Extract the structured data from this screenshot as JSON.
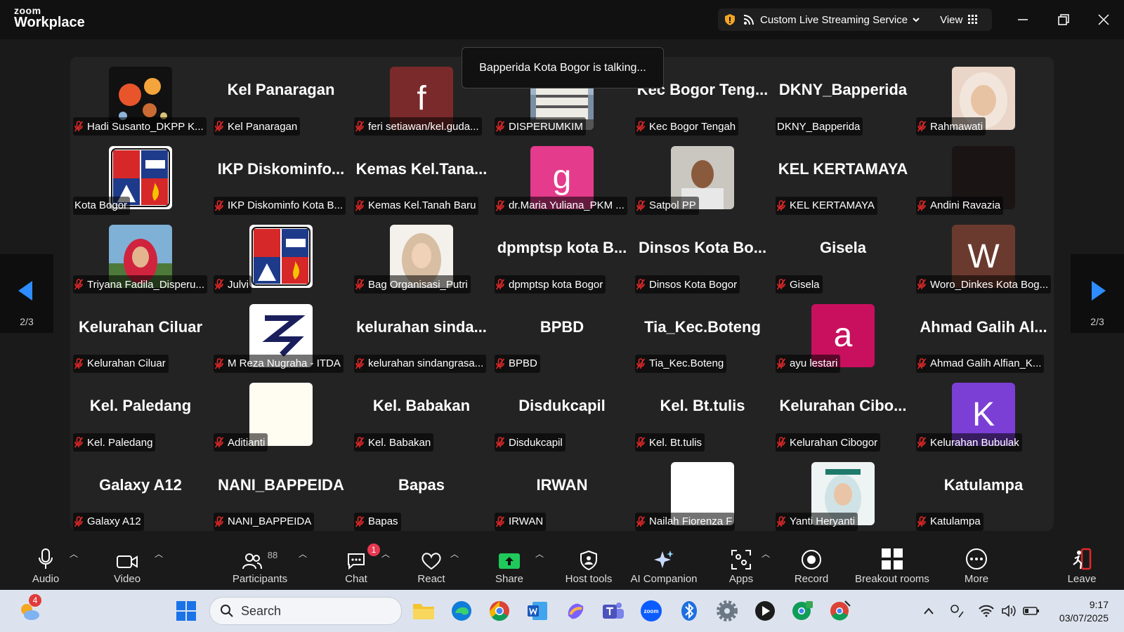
{
  "app": {
    "brand_top": "zoom",
    "brand_bottom": "Workplace"
  },
  "streaming": {
    "label": "Custom Live Streaming Service",
    "view_label": "View"
  },
  "toast": "Bapperida Kota Bogor is talking...",
  "page_indicator": {
    "left": "2/3",
    "right": "2/3"
  },
  "participants": [
    {
      "name": "Hadi Susanto_DKPP K...",
      "avatar": "planets",
      "big": ""
    },
    {
      "name": "Kel Panaragan",
      "big": "Kel Panaragan"
    },
    {
      "name": "feri setiawan/kel.guda...",
      "avatar": "letter",
      "letter": "f",
      "color": "#7a2a2a",
      "big": ""
    },
    {
      "name": "DISPERUMKIM",
      "avatar": "building",
      "big": ""
    },
    {
      "name": "Kec Bogor Tengah",
      "big": "Kec Bogor Teng..."
    },
    {
      "name": "DKNY_Bapperida",
      "big": "DKNY_Bapperida",
      "muted": false
    },
    {
      "name": "Rahmawati",
      "avatar": "photo-hijab-light",
      "big": ""
    },
    {
      "name": "Kota Bogor",
      "avatar": "crest-kota",
      "big": "",
      "muted": false
    },
    {
      "name": "IKP Diskominfo Kota B...",
      "big": "IKP Diskominfo..."
    },
    {
      "name": "Kemas Kel.Tanah Baru",
      "big": "Kemas Kel.Tana..."
    },
    {
      "name": "dr.Maria Yuliana_PKM ...",
      "avatar": "letter",
      "letter": "g",
      "color": "#e53b8c",
      "big": ""
    },
    {
      "name": "Satpol PP",
      "avatar": "photo-man",
      "big": ""
    },
    {
      "name": "KEL KERTAMAYA",
      "big": "KEL KERTAMAYA"
    },
    {
      "name": "Andini Ravazia",
      "avatar": "dark",
      "big": ""
    },
    {
      "name": "Triyana Fadila_Disperu...",
      "avatar": "photo-hijab-red",
      "big": ""
    },
    {
      "name": "Julvi",
      "avatar": "crest",
      "big": ""
    },
    {
      "name": "Bag Organisasi_Putri",
      "avatar": "photo-hijab-beige",
      "big": ""
    },
    {
      "name": "dpmptsp kota Bogor",
      "big": "dpmptsp kota B..."
    },
    {
      "name": "Dinsos Kota Bogor",
      "big": "Dinsos Kota Bo..."
    },
    {
      "name": "Gisela",
      "big": "Gisela"
    },
    {
      "name": "Woro_Dinkes Kota Bog...",
      "avatar": "letter",
      "letter": "W",
      "color": "#6b3a2e",
      "big": ""
    },
    {
      "name": "Kelurahan Ciluar",
      "big": "Kelurahan Ciluar"
    },
    {
      "name": "M Reza Nugraha - ITDA",
      "avatar": "logo-z",
      "big": ""
    },
    {
      "name": "kelurahan sindangrasa...",
      "big": "kelurahan sinda..."
    },
    {
      "name": "BPBD",
      "big": "BPBD"
    },
    {
      "name": "Tia_Kec.Boteng",
      "big": "Tia_Kec.Boteng"
    },
    {
      "name": "ayu lestari",
      "avatar": "letter",
      "letter": "a",
      "color": "#c8105e",
      "big": ""
    },
    {
      "name": "Ahmad Galih Alfian_K...",
      "big": "Ahmad Galih Al..."
    },
    {
      "name": "Kel. Paledang",
      "big": "Kel. Paledang"
    },
    {
      "name": "Aditianti",
      "avatar": "cream",
      "big": ""
    },
    {
      "name": "Kel. Babakan",
      "big": "Kel. Babakan"
    },
    {
      "name": "Disdukcapil",
      "big": "Disdukcapil"
    },
    {
      "name": "Kel. Bt.tulis",
      "big": "Kel. Bt.tulis"
    },
    {
      "name": "Kelurahan Cibogor",
      "big": "Kelurahan Cibo..."
    },
    {
      "name": "Kelurahan Bubulak",
      "avatar": "letter",
      "letter": "K",
      "color": "#7b3fd6",
      "big": ""
    },
    {
      "name": "Galaxy A12",
      "big": "Galaxy A12"
    },
    {
      "name": "NANI_BAPPEIDA",
      "big": "NANI_BAPPEIDA"
    },
    {
      "name": "Bapas",
      "big": "Bapas"
    },
    {
      "name": "IRWAN",
      "big": "IRWAN"
    },
    {
      "name": "Nailah Fiorenza F",
      "avatar": "white",
      "big": ""
    },
    {
      "name": "Yanti Heryanti",
      "avatar": "photo-hijab-green",
      "big": ""
    },
    {
      "name": "Katulampa",
      "big": "Katulampa"
    }
  ],
  "toolbar": {
    "audio": "Audio",
    "video": "Video",
    "participants": "Participants",
    "participants_count": "88",
    "chat": "Chat",
    "chat_badge": "1",
    "react": "React",
    "share": "Share",
    "host_tools": "Host tools",
    "ai_companion": "AI Companion",
    "apps": "Apps",
    "record": "Record",
    "breakout_rooms": "Breakout rooms",
    "more": "More",
    "leave": "Leave"
  },
  "taskbar": {
    "weather_badge": "4",
    "search_placeholder": "Search",
    "time": "9:17",
    "date": "03/07/2025"
  },
  "colors": {
    "share_green": "#1fca5b",
    "leave_red": "#e02828",
    "chat_badge": "#e8384f"
  }
}
